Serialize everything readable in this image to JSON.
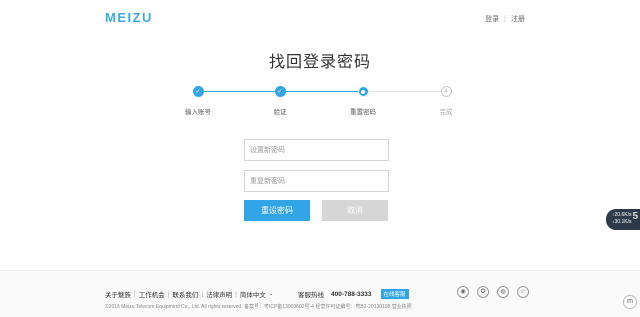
{
  "header": {
    "logo": "MEIZU",
    "login": "登录",
    "separator": "|",
    "register": "注册"
  },
  "page": {
    "title": "找回登录密码"
  },
  "steps": [
    {
      "label": "输入账号",
      "state": "done",
      "mark": "✓"
    },
    {
      "label": "验证",
      "state": "done",
      "mark": "✓"
    },
    {
      "label": "重置密码",
      "state": "current",
      "mark": ""
    },
    {
      "label": "完成",
      "state": "todo",
      "mark": "4"
    }
  ],
  "form": {
    "new_password_placeholder": "设置新密码",
    "confirm_password_placeholder": "重复新密码",
    "reset_label": "重设密码",
    "cancel_label": "取消"
  },
  "side_widget": {
    "up": "↑20.6K/s",
    "down": "↓30.1K/s",
    "value": "5"
  },
  "footer": {
    "links": [
      "关于魅族",
      "工作机会",
      "联系我们",
      "法律声明",
      "简体中文"
    ],
    "hotline_label": "客服热线",
    "hotline_number": "400-788-3333",
    "online_service": "在线客服",
    "copyright": "©2016 Meizu Telecom Equipment Co., Ltd. All rights reserved.  备案号：粤ICP备13003602号-4  经营许可证编号：粤B2-20130198  营业执照",
    "social_icons": [
      "weibo-icon",
      "qzone-icon",
      "wechat-icon",
      "star-icon"
    ],
    "corner_logo": "m"
  },
  "colors": {
    "accent": "#32a5e7",
    "brand": "#3fa9e3"
  }
}
